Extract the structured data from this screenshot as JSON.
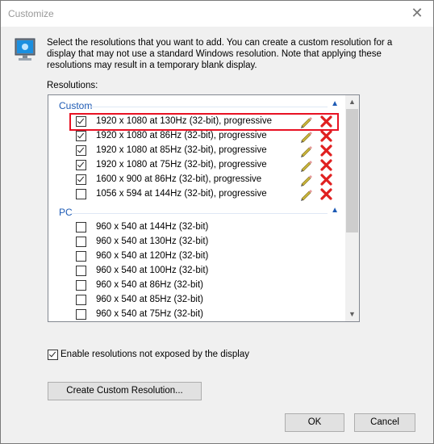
{
  "window": {
    "title": "Customize",
    "close_glyph": "✕"
  },
  "description": "Select the resolutions that you want to add. You can create a custom resolution for a display that may not use a standard Windows resolution. Note that applying these resolutions may result in a temporary blank display.",
  "resolutions_label": "Resolutions:",
  "groups": {
    "custom": {
      "label": "Custom",
      "items": [
        {
          "label": "1920 x 1080 at 130Hz (32-bit), progressive",
          "checked": true,
          "highlighted": true
        },
        {
          "label": "1920 x 1080 at 86Hz (32-bit), progressive",
          "checked": true
        },
        {
          "label": "1920 x 1080 at 85Hz (32-bit), progressive",
          "checked": true
        },
        {
          "label": "1920 x 1080 at 75Hz (32-bit), progressive",
          "checked": true
        },
        {
          "label": "1600 x 900 at 86Hz (32-bit), progressive",
          "checked": true
        },
        {
          "label": "1056 x 594 at 144Hz (32-bit), progressive",
          "checked": false
        }
      ]
    },
    "pc": {
      "label": "PC",
      "items": [
        {
          "label": "960 x 540 at 144Hz (32-bit)",
          "checked": false
        },
        {
          "label": "960 x 540 at 130Hz (32-bit)",
          "checked": false
        },
        {
          "label": "960 x 540 at 120Hz (32-bit)",
          "checked": false
        },
        {
          "label": "960 x 540 at 100Hz (32-bit)",
          "checked": false
        },
        {
          "label": "960 x 540 at 86Hz (32-bit)",
          "checked": false
        },
        {
          "label": "960 x 540 at 85Hz (32-bit)",
          "checked": false
        },
        {
          "label": "960 x 540 at 75Hz (32-bit)",
          "checked": false
        }
      ]
    }
  },
  "enable_resolutions": {
    "label": "Enable resolutions not exposed by the display",
    "checked": true
  },
  "buttons": {
    "create": "Create Custom Resolution...",
    "ok": "OK",
    "cancel": "Cancel"
  },
  "colors": {
    "accent": "#1e5bb5",
    "highlight_border": "#e81123",
    "delete": "#e02020"
  }
}
